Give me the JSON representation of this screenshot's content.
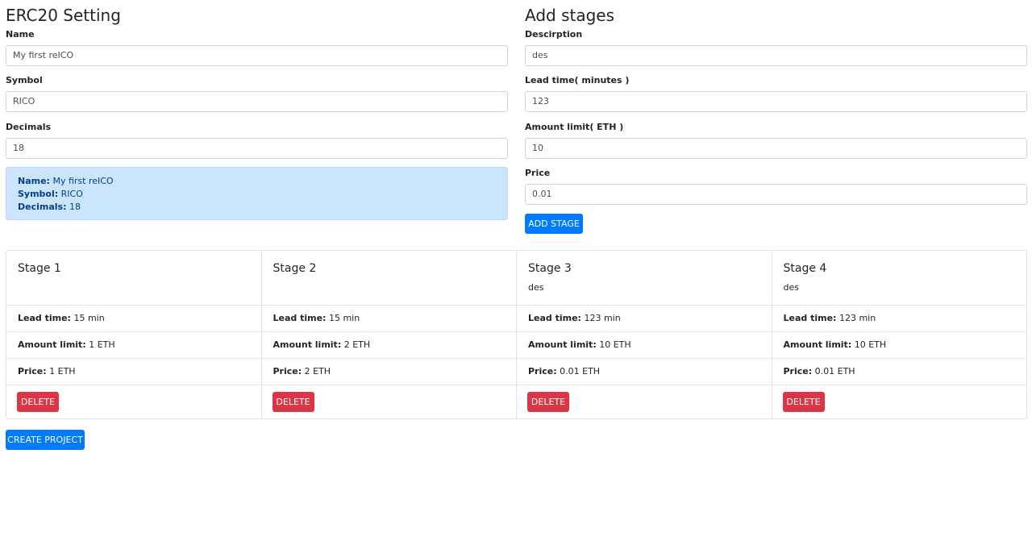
{
  "erc20": {
    "title": "ERC20 Setting",
    "name_label": "Name",
    "name_value": "My first reICO",
    "symbol_label": "Symbol",
    "symbol_value": "RICO",
    "decimals_label": "Decimals",
    "decimals_value": "18",
    "summary": {
      "name_label": "Name:",
      "name_value": "My first reICO",
      "symbol_label": "Symbol:",
      "symbol_value": "RICO",
      "decimals_label": "Decimals:",
      "decimals_value": "18"
    }
  },
  "add_stages": {
    "title": "Add stages",
    "description_label": "Descirption",
    "description_value": "des",
    "lead_time_label": "Lead time( minutes )",
    "lead_time_value": "123",
    "amount_limit_label": "Amount limit( ETH )",
    "amount_limit_value": "10",
    "price_label": "Price",
    "price_value": "0.01",
    "add_button": "ADD STAGE"
  },
  "stage_labels": {
    "lead_time": "Lead time:",
    "amount_limit": "Amount limit:",
    "price": "Price:",
    "delete": "DELETE"
  },
  "stages": [
    {
      "title": "Stage 1",
      "desc": "",
      "lead_time": "15 min",
      "amount_limit": "1 ETH",
      "price": "1 ETH"
    },
    {
      "title": "Stage 2",
      "desc": "",
      "lead_time": "15 min",
      "amount_limit": "2 ETH",
      "price": "2 ETH"
    },
    {
      "title": "Stage 3",
      "desc": "des",
      "lead_time": "123 min",
      "amount_limit": "10 ETH",
      "price": "0.01 ETH"
    },
    {
      "title": "Stage 4",
      "desc": "des",
      "lead_time": "123 min",
      "amount_limit": "10 ETH",
      "price": "0.01 ETH"
    }
  ],
  "create_button": "CREATE PROJECT",
  "colors": {
    "primary": "#007bff",
    "danger": "#dc3545",
    "info_bg": "#cce5ff",
    "info_text": "#004085"
  }
}
